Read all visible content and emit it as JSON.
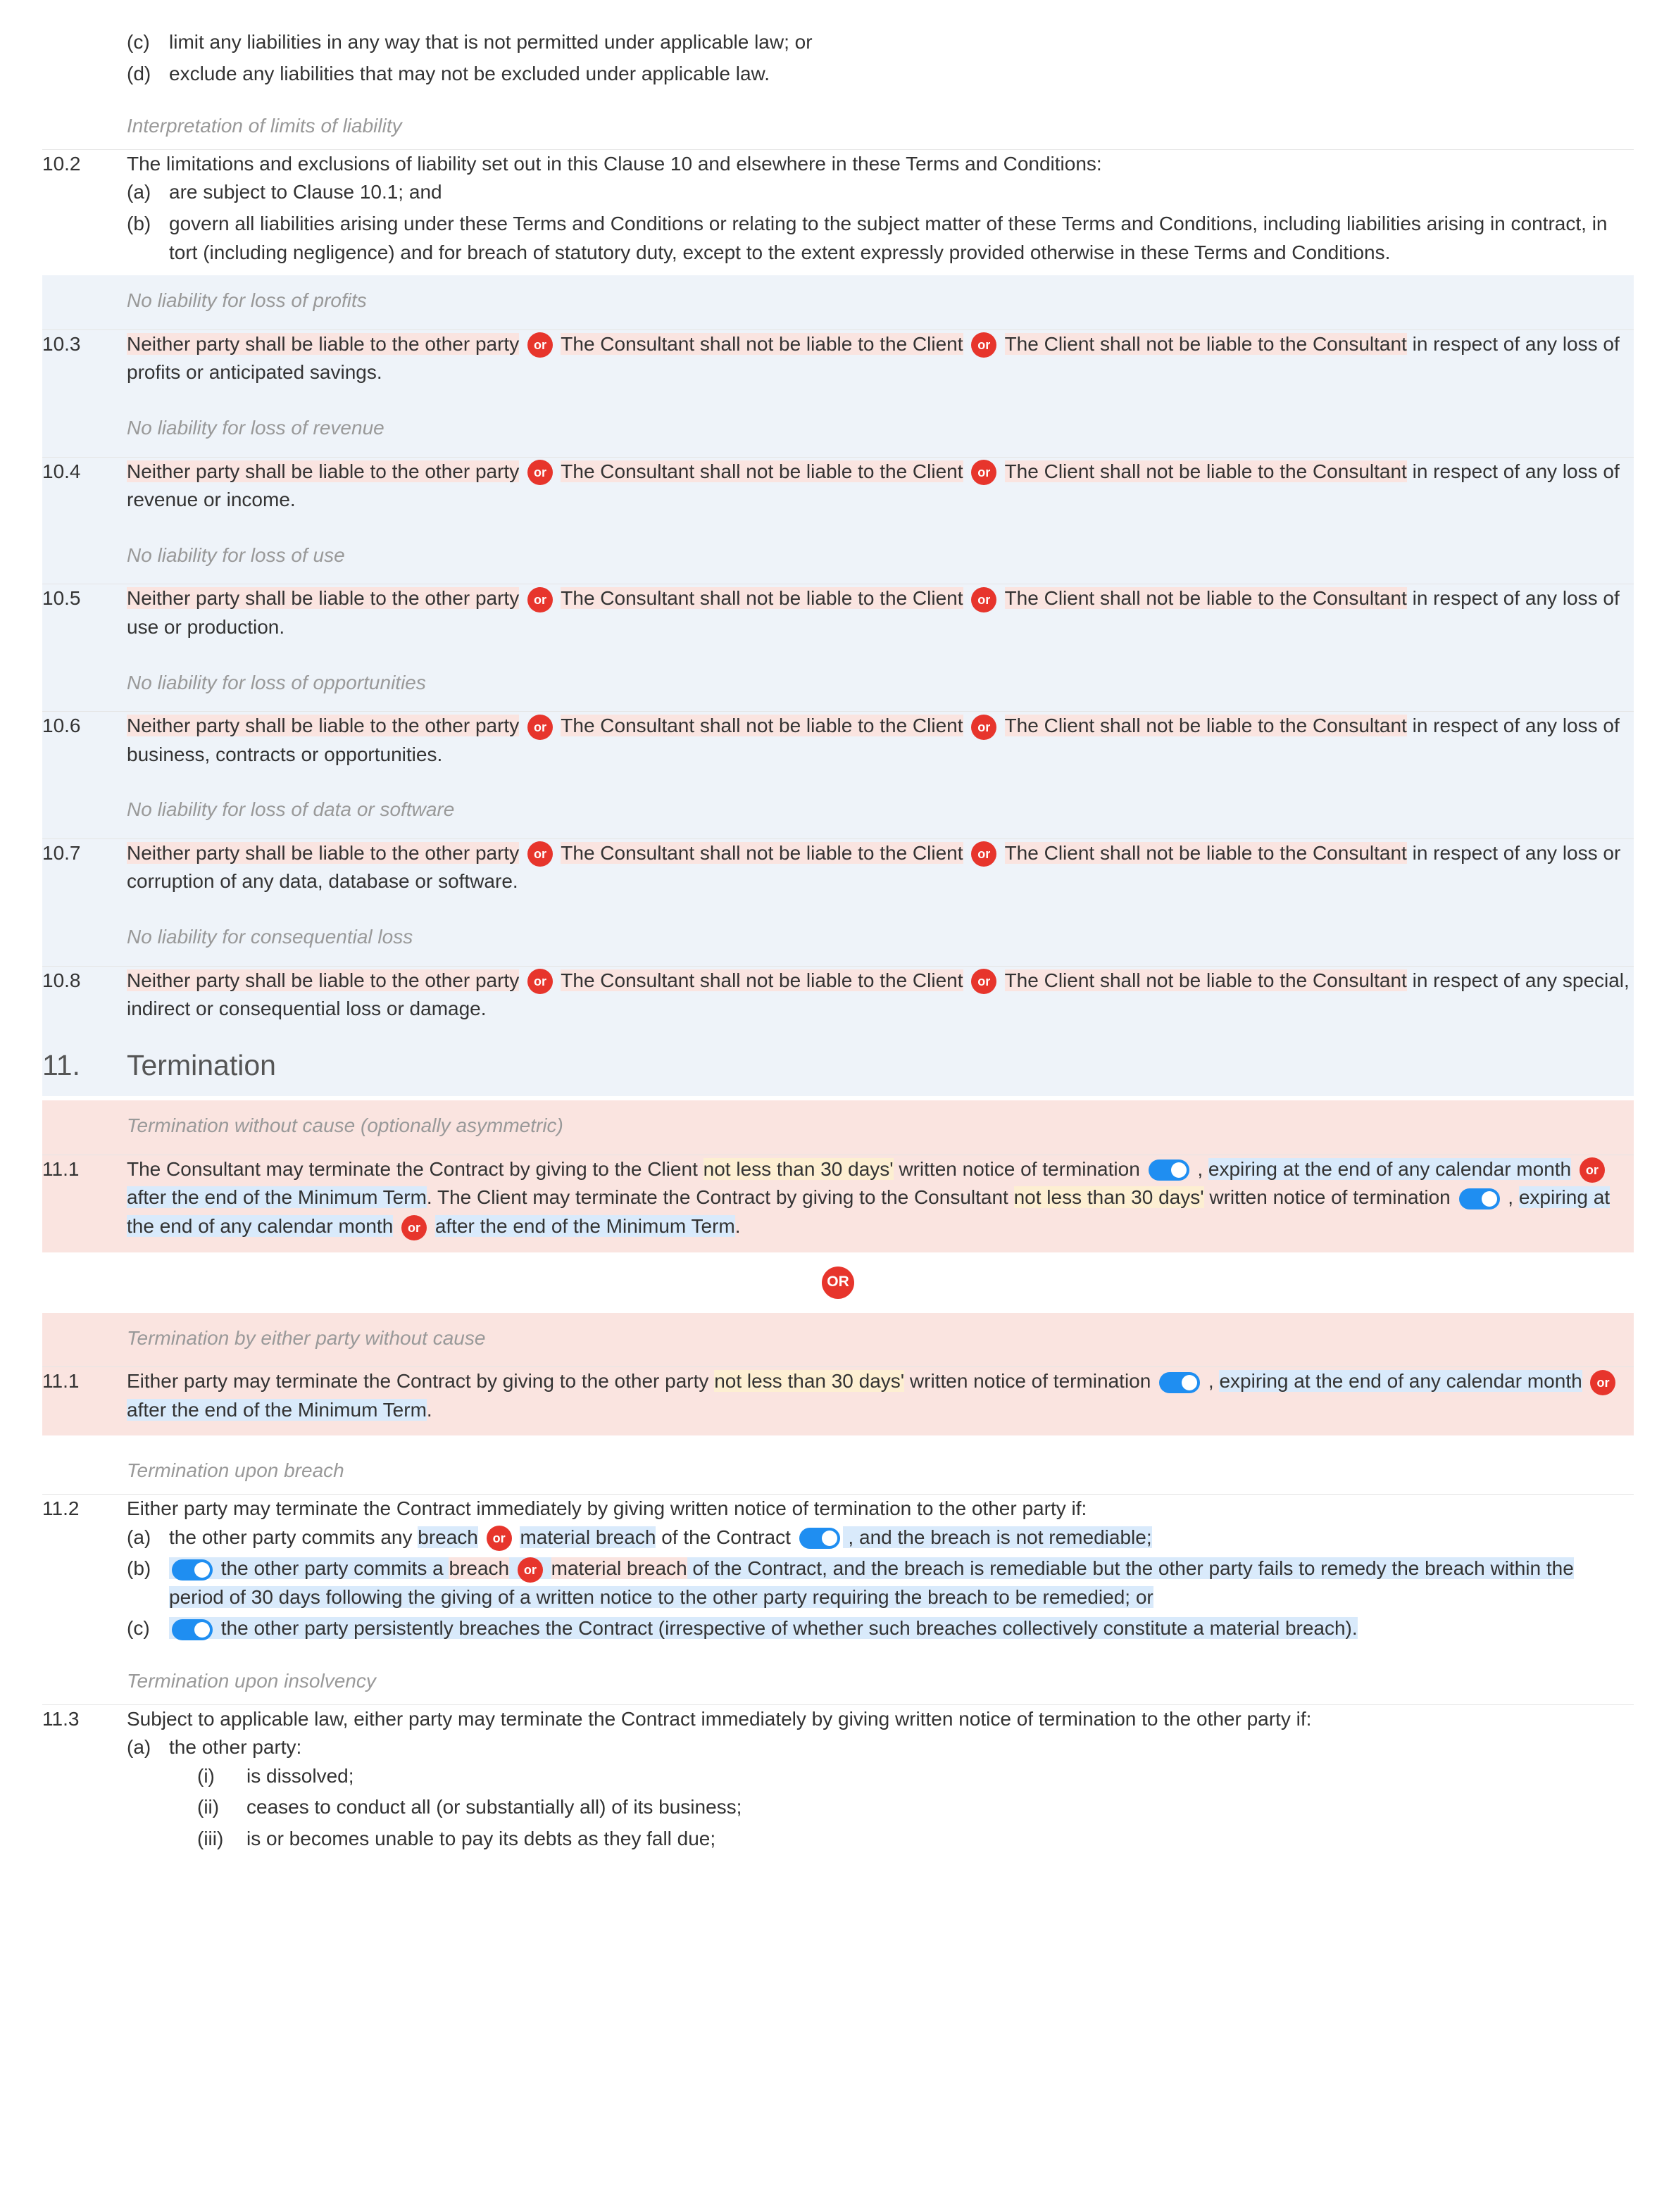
{
  "c_intro": {
    "c": "(c)",
    "c_text": "limit any liabilities in any way that is not permitted under applicable law; or",
    "d": "(d)",
    "d_text": "exclude any liabilities that may not be excluded under applicable law."
  },
  "sub_interpret": "Interpretation of limits of liability",
  "c10_2": {
    "num": "10.2",
    "intro": "The limitations and exclusions of liability set out in this Clause 10 and elsewhere in these Terms and Conditions:",
    "a": "(a)",
    "a_text": "are subject to Clause 10.1; and",
    "b": "(b)",
    "b_text": "govern all liabilities arising under these Terms and Conditions or relating to the subject matter of these Terms and Conditions, including liabilities arising in contract, in tort (including negligence) and for breach of statutory duty, except to the extent expressly provided otherwise in these Terms and Conditions."
  },
  "liability_common": {
    "opt1": "Neither party shall be liable to the other party",
    "opt2": "The Consultant shall not be liable to the Client",
    "opt3": "The Client shall not be liable to the Consultant"
  },
  "c10_3_head": "No liability for loss of profits",
  "c10_3_num": "10.3",
  "c10_3_tail": " in respect of any loss of profits or anticipated savings.",
  "c10_4_head": "No liability for loss of revenue",
  "c10_4_num": "10.4",
  "c10_4_tail": " in respect of any loss of revenue or income.",
  "c10_5_head": "No liability for loss of use",
  "c10_5_num": "10.5",
  "c10_5_tail": " in respect of any loss of use or production.",
  "c10_6_head": "No liability for loss of opportunities",
  "c10_6_num": "10.6",
  "c10_6_tail": " in respect of any loss of business, contracts or opportunities.",
  "c10_7_head": "No liability for loss of data or software",
  "c10_7_num": "10.7",
  "c10_7_tail": " in respect of any loss or corruption of any data, database or software.",
  "c10_8_head": "No liability for consequential loss",
  "c10_8_num": "10.8",
  "c10_8_tail": " in respect of any special, indirect or consequential loss or damage.",
  "s11_num": "11.",
  "s11_title": "Termination",
  "c11_1a_head": "Termination without cause (optionally asymmetric)",
  "c11_1a_num": "11.1",
  "c11_1a": {
    "p1": "The Consultant may terminate the Contract by giving to the Client ",
    "y1": "not less than 30 days'",
    "p2": " written notice of termination ",
    "comma": " , ",
    "b1": "expiring at the end of any calendar month",
    "p3": "after the end of the Minimum Term",
    "p4": ". The Client may terminate the Contract by giving to the Consultant ",
    "y2": "not less than 30 days'",
    "p5": " written notice of termination ",
    "b2": "expiring at the end of any calendar month",
    "p6": "after the end of the Minimum Term",
    "dot": "."
  },
  "or_label": "OR",
  "or_small": "or",
  "c11_1b_head": "Termination by either party without cause",
  "c11_1b_num": "11.1",
  "c11_1b": {
    "p1": "Either party may terminate the Contract by giving to the other party ",
    "y1": "not less than 30 days'",
    "p2": " written notice of termination ",
    "comma": " , ",
    "b1": "expiring at the end of any calendar month",
    "p3": "after the end of the Minimum Term",
    "dot": "."
  },
  "c11_2_head": "Termination upon breach",
  "c11_2_num": "11.2",
  "c11_2_intro": "Either party may terminate the Contract immediately by giving written notice of termination to the other party if:",
  "c11_2_a_m": "(a)",
  "c11_2_a": {
    "p1": "the other party commits any ",
    "b1": "breach",
    "b2": "material breach",
    "p2": " of the Contract ",
    "p3": " , and the breach is not remediable;"
  },
  "c11_2_b_m": "(b)",
  "c11_2_b": {
    "p1": "the other party commits a ",
    "b1": "breach",
    "b2": "material breach",
    "p2": " of the Contract, and the breach is remediable but the other party fails to remedy the breach within the period of 30 days following the giving of a written notice to the other party requiring the breach to be remedied; or"
  },
  "c11_2_c_m": "(c)",
  "c11_2_c": "the other party persistently breaches the Contract (irrespective of whether such breaches collectively constitute a material breach).",
  "c11_3_head": "Termination upon insolvency",
  "c11_3_num": "11.3",
  "c11_3_intro": "Subject to applicable law, either party may terminate the Contract immediately by giving written notice of termination to the other party if:",
  "c11_3_a_m": "(a)",
  "c11_3_a": "the other party:",
  "c11_3_i_m": "(i)",
  "c11_3_i": "is dissolved;",
  "c11_3_ii_m": "(ii)",
  "c11_3_ii": "ceases to conduct all (or substantially all) of its business;",
  "c11_3_iii_m": "(iii)",
  "c11_3_iii": "is or becomes unable to pay its debts as they fall due;"
}
